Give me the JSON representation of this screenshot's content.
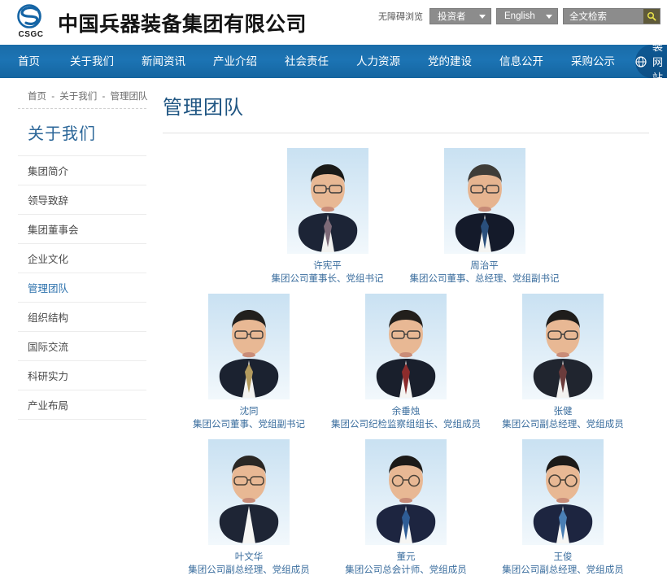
{
  "header": {
    "logo_abbr": "CSGC",
    "company_name": "中国兵器装备集团有限公司",
    "accessibility_label": "无障碍浏览",
    "investor_dropdown": "投资者",
    "language_dropdown": "English",
    "search_placeholder": "全文检索",
    "search_icon": "magnifier-icon"
  },
  "nav": {
    "items": [
      {
        "label": "首页"
      },
      {
        "label": "关于我们"
      },
      {
        "label": "新闻资讯"
      },
      {
        "label": "产业介绍"
      },
      {
        "label": "社会责任"
      },
      {
        "label": "人力资源"
      },
      {
        "label": "党的建设"
      },
      {
        "label": "信息公开"
      },
      {
        "label": "采购公示"
      }
    ],
    "site_group_label": "兵装网站群",
    "site_group_icon": "globe-icon"
  },
  "breadcrumb": {
    "items": [
      "首页",
      "关于我们",
      "管理团队"
    ],
    "separator": "-"
  },
  "sidebar": {
    "title": "关于我们",
    "items": [
      {
        "label": "集团简介",
        "active": false
      },
      {
        "label": "领导致辞",
        "active": false
      },
      {
        "label": "集团董事会",
        "active": false
      },
      {
        "label": "企业文化",
        "active": false
      },
      {
        "label": "管理团队",
        "active": true
      },
      {
        "label": "组织结构",
        "active": false
      },
      {
        "label": "国际交流",
        "active": false
      },
      {
        "label": "科研实力",
        "active": false
      },
      {
        "label": "产业布局",
        "active": false
      }
    ]
  },
  "main": {
    "page_title": "管理团队",
    "rows": [
      {
        "members": [
          {
            "name": "许宪平",
            "role": "集团公司董事长、党组书记",
            "photo_alt": "portrait-photo"
          },
          {
            "name": "周治平",
            "role": "集团公司董事、总经理、党组副书记",
            "photo_alt": "portrait-photo"
          }
        ]
      },
      {
        "members": [
          {
            "name": "沈同",
            "role": "集团公司董事、党组副书记",
            "photo_alt": "portrait-photo"
          },
          {
            "name": "余垂烛",
            "role": "集团公司纪检监察组组长、党组成员",
            "photo_alt": "portrait-photo"
          },
          {
            "name": "张健",
            "role": "集团公司副总经理、党组成员",
            "photo_alt": "portrait-photo"
          }
        ]
      },
      {
        "members": [
          {
            "name": "叶文华",
            "role": "集团公司副总经理、党组成员",
            "photo_alt": "portrait-photo"
          },
          {
            "name": "董元",
            "role": "集团公司总会计师、党组成员",
            "photo_alt": "portrait-photo"
          },
          {
            "name": "王俊",
            "role": "集团公司副总经理、党组成员",
            "photo_alt": "portrait-photo"
          }
        ]
      }
    ]
  },
  "colors": {
    "nav_blue": "#1c74b4",
    "nav_dark_blue": "#0e5893",
    "title_blue": "#1f5582",
    "link_blue": "#3b6e9e",
    "active_blue": "#2d72ad",
    "control_gray": "#8c8c8c"
  }
}
